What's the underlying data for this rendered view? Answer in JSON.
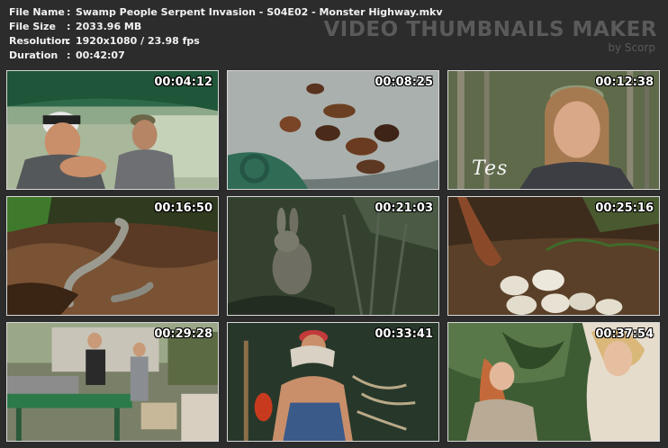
{
  "info": {
    "file_name_label": "File Name",
    "file_name_value": "Swamp People Serpent Invasion - S04E02 - Monster Highway.mkv",
    "file_size_label": "File Size",
    "file_size_value": "2033.96 MB",
    "resolution_label": "Resolution",
    "resolution_value": "1920x1080 / 23.98 fps",
    "duration_label": "Duration",
    "duration_value": "00:42:07",
    "separator": ":"
  },
  "brand": {
    "title": "VIDEO THUMBNAILS MAKER",
    "subtitle": "by Scorp"
  },
  "thumbnails": [
    {
      "timestamp": "00:04:12"
    },
    {
      "timestamp": "00:08:25"
    },
    {
      "timestamp": "00:12:38",
      "caption": "Tes"
    },
    {
      "timestamp": "00:16:50"
    },
    {
      "timestamp": "00:21:03"
    },
    {
      "timestamp": "00:25:16"
    },
    {
      "timestamp": "00:29:28"
    },
    {
      "timestamp": "00:33:41"
    },
    {
      "timestamp": "00:37:54"
    }
  ],
  "colors": {
    "background": "#2c2c2c",
    "text": "#f2f2f2",
    "brand": "#5a5a5a",
    "frame_border": "#d8d8d8"
  }
}
